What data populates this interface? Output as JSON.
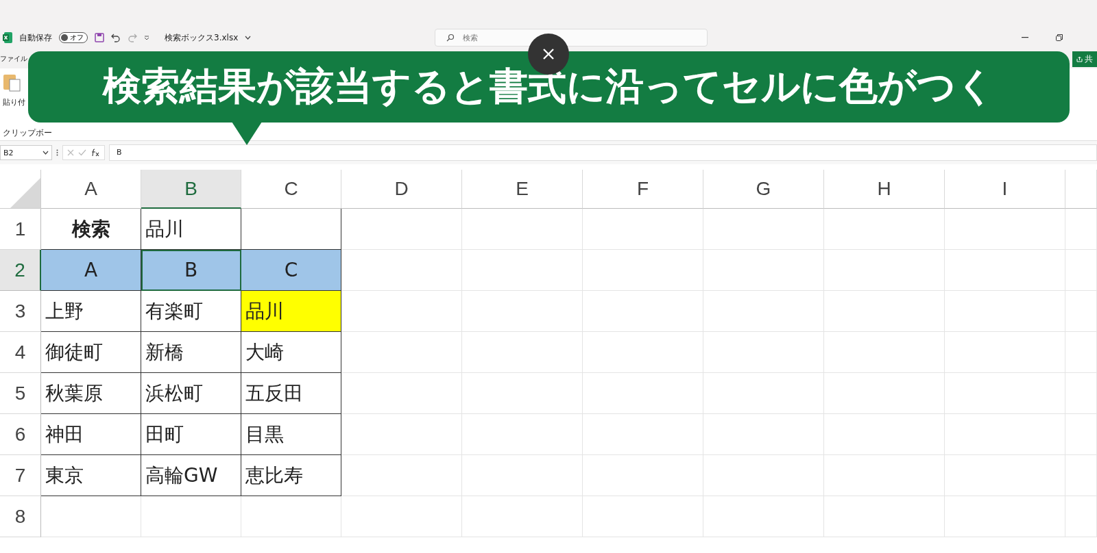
{
  "title_bar": {
    "autosave_label": "自動保存",
    "autosave_toggle": {
      "label": "オフ",
      "on": false
    },
    "filename": "検索ボックス3.xlsx",
    "search": {
      "placeholder": "検索"
    }
  },
  "ribbon": {
    "tabs": [
      {
        "label": "ファイル"
      }
    ],
    "share": "共",
    "paste_label": "貼り付",
    "group_label": "クリップボー"
  },
  "formula_bar": {
    "name_box": "B2",
    "formula": "B"
  },
  "columns": [
    {
      "label": "A",
      "selected": false
    },
    {
      "label": "B",
      "selected": true
    },
    {
      "label": "C",
      "selected": false
    },
    {
      "label": "D",
      "selected": false
    },
    {
      "label": "E",
      "selected": false
    },
    {
      "label": "F",
      "selected": false
    },
    {
      "label": "G",
      "selected": false
    },
    {
      "label": "H",
      "selected": false
    },
    {
      "label": "I",
      "selected": false
    }
  ],
  "rows": [
    {
      "number": "1",
      "selected": false,
      "cells": [
        {
          "text": "検索",
          "bold": true,
          "centered": true,
          "selected": false
        },
        {
          "text": "品川",
          "bold": false,
          "centered": false,
          "selected": false
        },
        {
          "selected": false
        }
      ]
    },
    {
      "number": "2",
      "selected": true,
      "cells": [
        {
          "text": "A",
          "bold": false,
          "centered": true,
          "color": "#9fc5e8",
          "selected": false
        },
        {
          "text": "B",
          "bold": false,
          "centered": true,
          "color": "#9fc5e8",
          "selected": true
        },
        {
          "text": "C",
          "bold": false,
          "centered": true,
          "color": "#9fc5e8",
          "selected": false
        }
      ]
    },
    {
      "number": "3",
      "selected": false,
      "cells": [
        {
          "text": "上野",
          "bold": false,
          "centered": false,
          "selected": false
        },
        {
          "text": "有楽町",
          "bold": false,
          "centered": false,
          "selected": false
        },
        {
          "text": "品川",
          "bold": false,
          "centered": false,
          "color": "#ffff00",
          "selected": false
        }
      ]
    },
    {
      "number": "4",
      "selected": false,
      "cells": [
        {
          "text": "御徒町",
          "bold": false,
          "centered": false,
          "selected": false
        },
        {
          "text": "新橋",
          "bold": false,
          "centered": false,
          "selected": false
        },
        {
          "text": "大崎",
          "bold": false,
          "centered": false,
          "selected": false
        }
      ]
    },
    {
      "number": "5",
      "selected": false,
      "cells": [
        {
          "text": "秋葉原",
          "bold": false,
          "centered": false,
          "selected": false
        },
        {
          "text": "浜松町",
          "bold": false,
          "centered": false,
          "selected": false
        },
        {
          "text": "五反田",
          "bold": false,
          "centered": false,
          "selected": false
        }
      ]
    },
    {
      "number": "6",
      "selected": false,
      "cells": [
        {
          "text": "神田",
          "bold": false,
          "centered": false,
          "selected": false
        },
        {
          "text": "田町",
          "bold": false,
          "centered": false,
          "selected": false
        },
        {
          "text": "目黒",
          "bold": false,
          "centered": false,
          "selected": false
        }
      ]
    },
    {
      "number": "7",
      "selected": false,
      "cells": [
        {
          "text": "東京",
          "bold": false,
          "centered": false,
          "selected": false
        },
        {
          "text": "高輪GW",
          "bold": false,
          "centered": false,
          "selected": false
        },
        {
          "text": "恵比寿",
          "bold": false,
          "centered": false,
          "selected": false
        }
      ]
    },
    {
      "number": "8",
      "selected": false,
      "cells": []
    }
  ],
  "caption": {
    "text": "検索結果が該当すると書式に沿ってセルに色がつく"
  }
}
